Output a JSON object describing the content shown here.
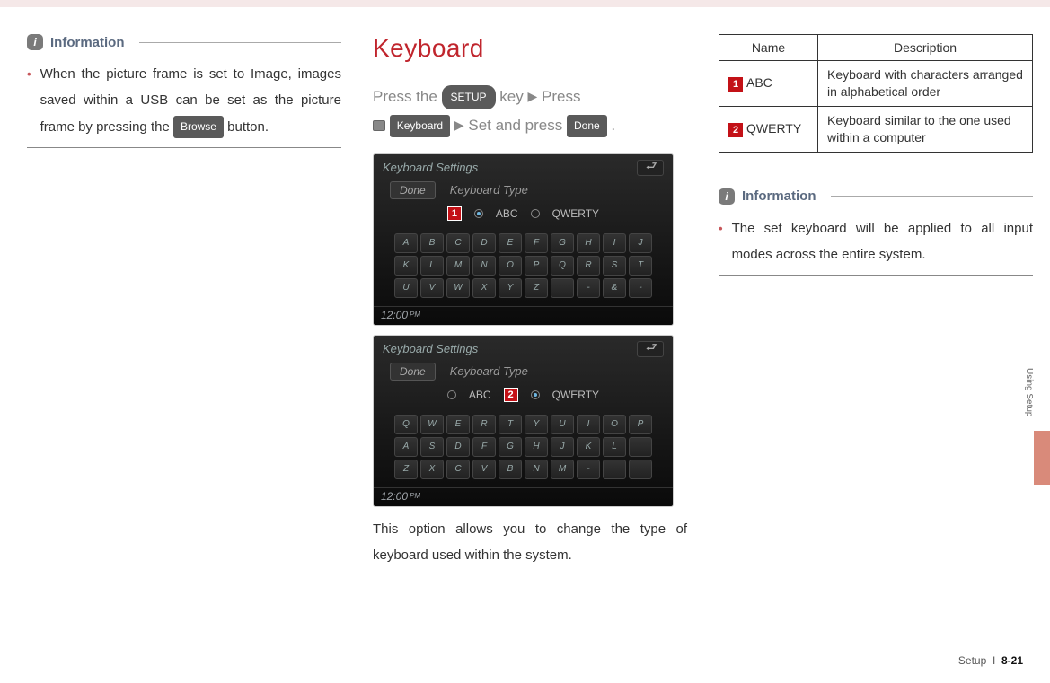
{
  "left": {
    "info_label": "Information",
    "info_icon": "i",
    "bullet": {
      "pre": "When the picture frame is set to Image, images saved within a USB can be set as the picture frame by pressing the ",
      "browse": "Browse",
      "post": " button."
    }
  },
  "mid": {
    "title": "Keyboard",
    "instr": {
      "p1": "Press the ",
      "setup": "SETUP",
      "p2": " key ",
      "arrow": "▶",
      "p3": " Press ",
      "keyboard": "Keyboard",
      "p4": " Set and press ",
      "done": "Done",
      "period": " ."
    },
    "ss1": {
      "title": "Keyboard Settings",
      "done": "Done",
      "type": "Keyboard Type",
      "opt1": "ABC",
      "opt2": "QWERTY",
      "callout": "1",
      "rows": [
        [
          "A",
          "B",
          "C",
          "D",
          "E",
          "F",
          "G",
          "H",
          "I",
          "J"
        ],
        [
          "K",
          "L",
          "M",
          "N",
          "O",
          "P",
          "Q",
          "R",
          "S",
          "T"
        ],
        [
          "U",
          "V",
          "W",
          "X",
          "Y",
          "Z",
          " ",
          "-",
          "&",
          "-"
        ]
      ],
      "time": "12:00",
      "pm": "PM"
    },
    "ss2": {
      "title": "Keyboard Settings",
      "done": "Done",
      "type": "Keyboard Type",
      "opt1": "ABC",
      "opt2": "QWERTY",
      "callout": "2",
      "rows": [
        [
          "Q",
          "W",
          "E",
          "R",
          "T",
          "Y",
          "U",
          "I",
          "O",
          "P"
        ],
        [
          "A",
          "S",
          "D",
          "F",
          "G",
          "H",
          "J",
          "K",
          "L",
          " "
        ],
        [
          "Z",
          "X",
          "C",
          "V",
          "B",
          "N",
          "M",
          "-",
          " ",
          " "
        ]
      ],
      "time": "12:00",
      "pm": "PM"
    },
    "caption": "This option allows you to change the type of keyboard used within the system."
  },
  "right": {
    "table": {
      "h_name": "Name",
      "h_desc": "Description",
      "rows": [
        {
          "num": "1",
          "name": "ABC",
          "desc": "Keyboard with characters arranged in alphabetical order"
        },
        {
          "num": "2",
          "name": "QWERTY",
          "desc": "Keyboard similar to the one used within a computer"
        }
      ]
    },
    "info_label": "Information",
    "info_icon": "i",
    "bullet": "The set keyboard will be applied to all input modes across the entire system."
  },
  "side_tab": "Using Setup",
  "footer": {
    "section": "Setup",
    "sep": "I",
    "page": "8-21"
  }
}
